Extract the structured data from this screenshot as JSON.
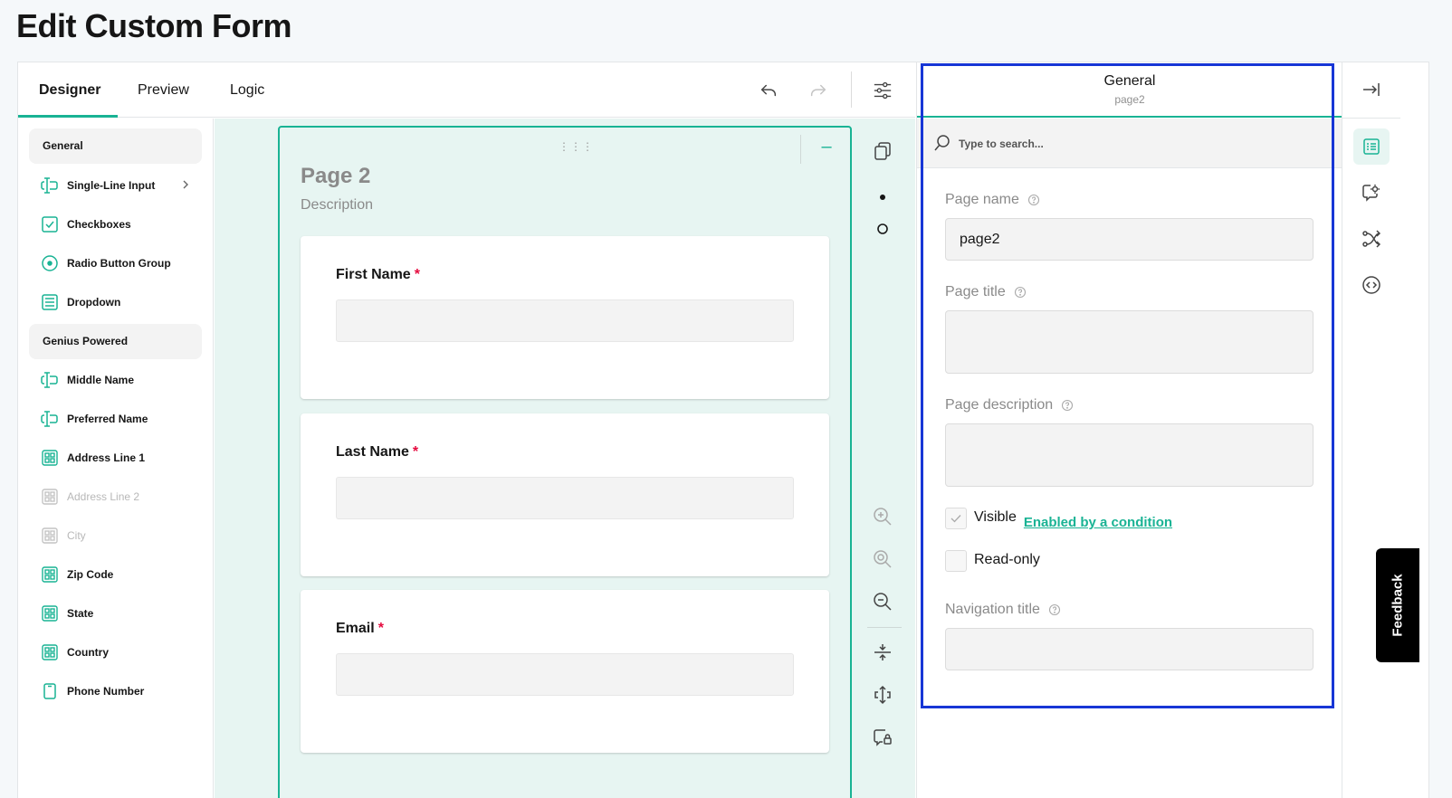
{
  "page": {
    "title": "Edit Custom Form"
  },
  "tabs": [
    {
      "label": "Designer",
      "active": true
    },
    {
      "label": "Preview",
      "active": false
    },
    {
      "label": "Logic",
      "active": false
    }
  ],
  "toolbar": {
    "undo_icon": "undo-icon",
    "redo_icon": "redo-icon",
    "settings_icon": "settings-sliders-icon"
  },
  "toolbox": {
    "categories": [
      "General",
      "Genius Powered"
    ],
    "general_items": [
      {
        "label": "Single-Line Input",
        "icon": "text-input-icon"
      },
      {
        "label": "Checkboxes",
        "icon": "checkbox-icon"
      },
      {
        "label": "Radio Button Group",
        "icon": "radio-icon"
      },
      {
        "label": "Dropdown",
        "icon": "dropdown-icon"
      }
    ],
    "genius_items": [
      {
        "label": "Middle Name",
        "icon": "text-input-icon",
        "disabled": false
      },
      {
        "label": "Preferred Name",
        "icon": "text-input-icon",
        "disabled": false
      },
      {
        "label": "Address Line 1",
        "icon": "panel-grid-icon",
        "disabled": false
      },
      {
        "label": "Address Line 2",
        "icon": "panel-grid-icon",
        "disabled": true
      },
      {
        "label": "City",
        "icon": "panel-grid-icon",
        "disabled": true
      },
      {
        "label": "Zip Code",
        "icon": "panel-grid-icon",
        "disabled": false
      },
      {
        "label": "State",
        "icon": "panel-grid-icon",
        "disabled": false
      },
      {
        "label": "Country",
        "icon": "panel-grid-icon",
        "disabled": false
      },
      {
        "label": "Phone Number",
        "icon": "phone-icon",
        "disabled": false
      }
    ]
  },
  "design_page": {
    "title": "Page 2",
    "description": "Description",
    "questions": [
      {
        "title": "First Name",
        "required_mark": "*"
      },
      {
        "title": "Last Name",
        "required_mark": "*"
      },
      {
        "title": "Email",
        "required_mark": "*"
      }
    ]
  },
  "property_grid": {
    "header_title": "General",
    "header_subtitle": "page2",
    "search_placeholder": "Type to search...",
    "page_name_label": "Page name",
    "page_name_value": "page2",
    "page_title_label": "Page title",
    "page_title_value": "",
    "page_description_label": "Page description",
    "page_description_value": "",
    "visible_label": "Visible",
    "visible_checked": true,
    "condition_link": "Enabled by a condition",
    "readonly_label": "Read-only",
    "readonly_checked": false,
    "navigation_title_label": "Navigation title",
    "navigation_title_value": ""
  },
  "feedback_label": "Feedback",
  "colors": {
    "accent": "#19b394",
    "focus": "#1736d6",
    "required": "#e50a3e"
  }
}
